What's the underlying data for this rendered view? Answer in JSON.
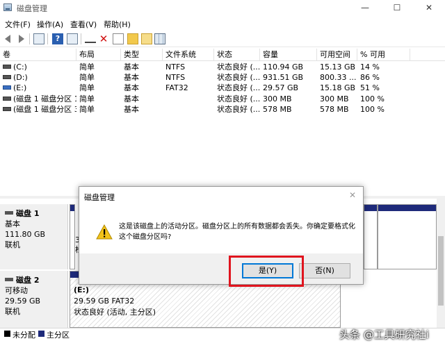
{
  "window": {
    "title": "磁盘管理",
    "min": "—",
    "max": "☐",
    "close": "✕"
  },
  "menu": [
    "文件(F)",
    "操作(A)",
    "查看(V)",
    "帮助(H)"
  ],
  "toolbar": [
    "back-icon",
    "forward-icon",
    "properties-icon",
    "help-icon",
    "connect-icon",
    "delete-icon",
    "check-icon",
    "folder-icon",
    "view-icon"
  ],
  "columns": [
    "卷",
    "布局",
    "类型",
    "文件系统",
    "状态",
    "容量",
    "可用空间",
    "% 可用"
  ],
  "volumes": [
    [
      "(C:)",
      "简单",
      "基本",
      "NTFS",
      "状态良好 (...",
      "110.94 GB",
      "15.13 GB",
      "14 %"
    ],
    [
      "(D:)",
      "简单",
      "基本",
      "NTFS",
      "状态良好 (...",
      "931.51 GB",
      "800.33 ...",
      "86 %"
    ],
    [
      "(E:)",
      "简单",
      "基本",
      "FAT32",
      "状态良好 (...",
      "29.57 GB",
      "15.18 GB",
      "51 %"
    ],
    [
      "(磁盘 1 磁盘分区 1)",
      "简单",
      "基本",
      "",
      "状态良好 (...",
      "300 MB",
      "300 MB",
      "100 %"
    ],
    [
      "(磁盘 1 磁盘分区 3)",
      "简单",
      "基本",
      "",
      "状态良好 (...",
      "578 MB",
      "578 MB",
      "100 %"
    ]
  ],
  "disks": [
    {
      "name": "磁盘 1",
      "type": "基本",
      "size": "111.80 GB",
      "status": "联机",
      "partial_chars": [
        "3",
        "松"
      ]
    },
    {
      "name": "磁盘 2",
      "type": "可移动",
      "size": "29.59 GB",
      "status": "联机",
      "partition": {
        "name": "(E:)",
        "size": "29.59 GB FAT32",
        "status": "状态良好 (活动, 主分区)"
      }
    }
  ],
  "legend": [
    {
      "label": "未分配",
      "color": "#000000"
    },
    {
      "label": "主分区",
      "color": "#1e2a7a"
    }
  ],
  "dialog": {
    "title": "磁盘管理",
    "close": "✕",
    "message": "这是该磁盘上的活动分区。磁盘分区上的所有数据都会丢失。你确定要格式化这个磁盘分区吗?",
    "yes": "是(Y)",
    "no": "否(N)"
  },
  "watermark": "头条 @工具研究社i"
}
